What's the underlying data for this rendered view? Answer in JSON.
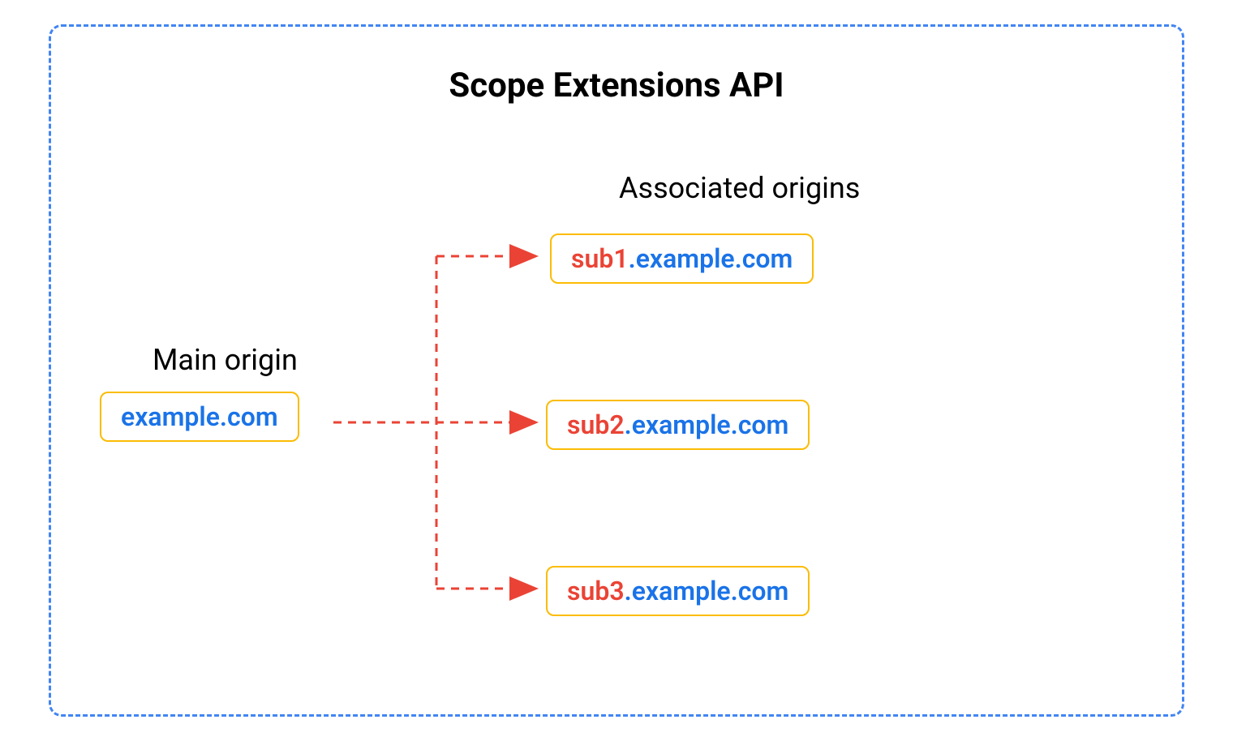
{
  "title": "Scope Extensions API",
  "mainOrigin": {
    "label": "Main origin",
    "domain": "example.com"
  },
  "associated": {
    "label": "Associated origins",
    "origins": [
      {
        "prefix": "sub1",
        "domain": ".example.com"
      },
      {
        "prefix": "sub2",
        "domain": ".example.com"
      },
      {
        "prefix": "sub3",
        "domain": ".example.com"
      }
    ]
  },
  "colors": {
    "border": "#4285F4",
    "boxBorder": "#FBBC04",
    "arrow": "#EA4335",
    "prefix": "#EA4335",
    "domain": "#1A73E8"
  }
}
